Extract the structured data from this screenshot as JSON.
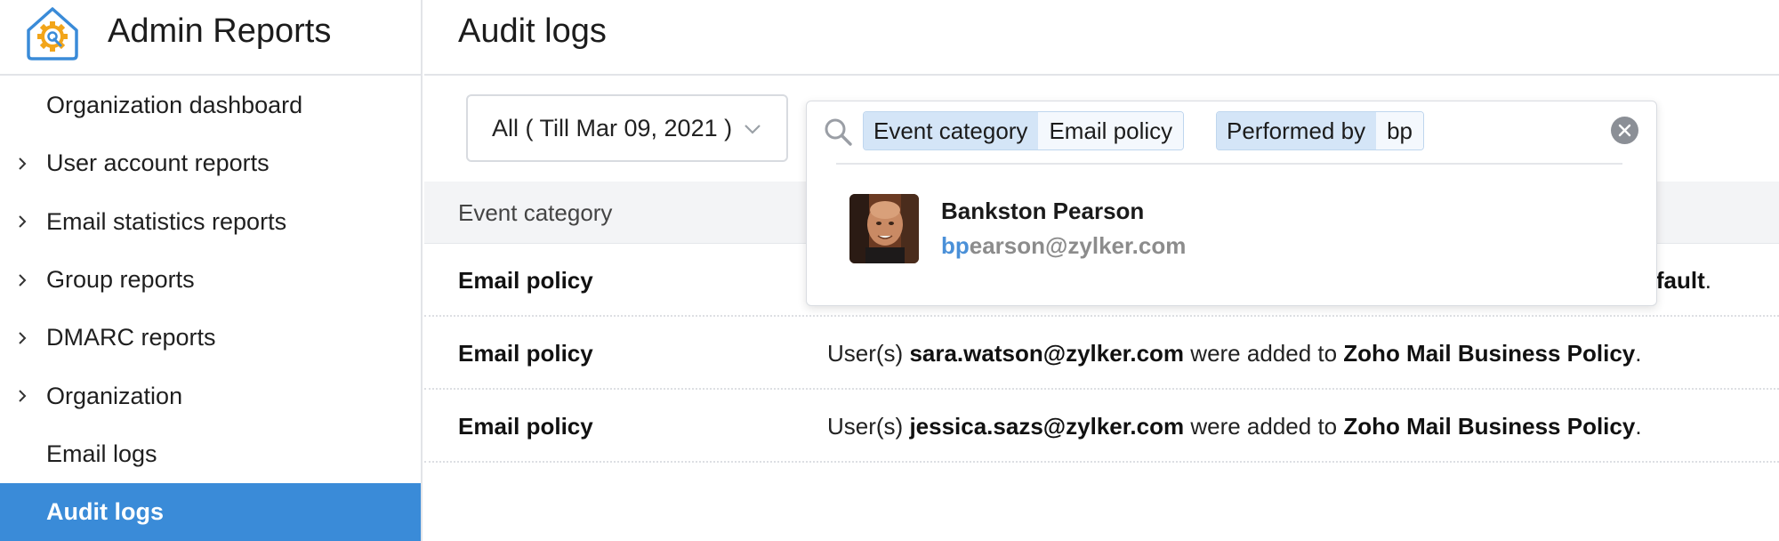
{
  "app": {
    "title": "Admin Reports",
    "logo_icon": "settings-house-icon"
  },
  "sidebar": {
    "items": [
      {
        "label": "Organization dashboard",
        "expandable": false,
        "active": false
      },
      {
        "label": "User account reports",
        "expandable": true,
        "active": false
      },
      {
        "label": "Email statistics reports",
        "expandable": true,
        "active": false
      },
      {
        "label": "Group reports",
        "expandable": true,
        "active": false
      },
      {
        "label": "DMARC reports",
        "expandable": true,
        "active": false
      },
      {
        "label": "Organization",
        "expandable": true,
        "active": false
      },
      {
        "label": "Email logs",
        "expandable": false,
        "active": false
      },
      {
        "label": "Audit logs",
        "expandable": false,
        "active": true
      }
    ]
  },
  "page": {
    "title": "Audit logs"
  },
  "filters": {
    "date_range": "All ( Till Mar 09, 2021 )"
  },
  "search": {
    "chips": [
      {
        "key": "Event category",
        "value": "Email policy"
      },
      {
        "key": "Performed by",
        "value": "bp"
      }
    ],
    "results": [
      {
        "name": "Bankston Pearson",
        "email_match": "bp",
        "email_rest": "earson@zylker.com"
      }
    ]
  },
  "table": {
    "columns": [
      "Event category"
    ],
    "rows": [
      {
        "category": "Email policy",
        "tail_bold": "fault",
        "tail_end": "."
      },
      {
        "category": "Email policy",
        "prefix": "User(s) ",
        "user": "sara.watson@zylker.com",
        "middle": " were added to ",
        "policy": "Zoho Mail Business Policy",
        "end": "."
      },
      {
        "category": "Email policy",
        "prefix": "User(s) ",
        "user": "jessica.sazs@zylker.com",
        "middle": " were added to ",
        "policy": "Zoho Mail Business Policy",
        "end": "."
      }
    ]
  },
  "colors": {
    "accent": "#3a8bd8",
    "chip_key_bg": "#d4e5f7",
    "highlight": "#4a90d8"
  }
}
